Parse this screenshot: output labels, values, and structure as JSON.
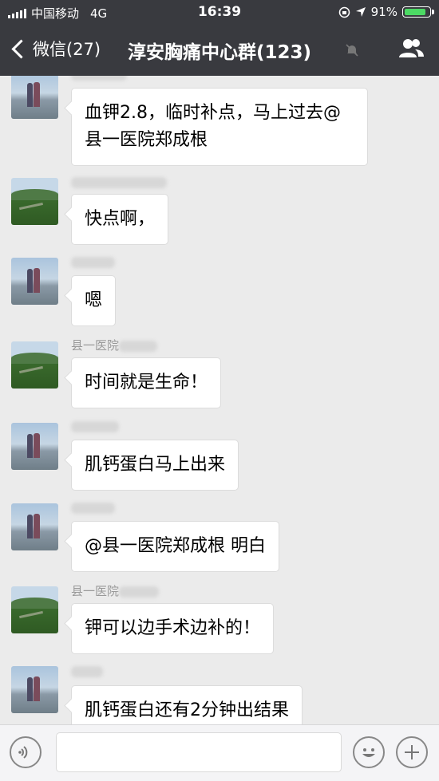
{
  "status_bar": {
    "carrier": "中国移动",
    "network": "4G",
    "time": "16:39",
    "battery": "91%",
    "battery_level": 0.91
  },
  "nav": {
    "back_label": "微信(27)",
    "title": "淳安胸痛中心群(123)"
  },
  "messages": [
    {
      "avatar": "beach-avatar",
      "sender": "",
      "text_lines": [
        "血钾2.8，临时补点，马上过去@",
        "县一医院郑成根"
      ]
    },
    {
      "avatar": "hill-avatar",
      "sender": "",
      "text_lines": [
        "快点啊，"
      ]
    },
    {
      "avatar": "beach-avatar",
      "sender": "",
      "text_lines": [
        "嗯"
      ]
    },
    {
      "avatar": "hill-avatar",
      "sender": "县一医院",
      "text_lines": [
        "时间就是生命！"
      ]
    },
    {
      "avatar": "beach-avatar",
      "sender": "",
      "text_lines": [
        "肌钙蛋白马上出来"
      ]
    },
    {
      "avatar": "beach-avatar",
      "sender": "",
      "text_lines": [
        "@县一医院郑成根 明白"
      ]
    },
    {
      "avatar": "hill-avatar",
      "sender": "县一医院",
      "text_lines": [
        "钾可以边手术边补的！"
      ]
    },
    {
      "avatar": "beach-avatar",
      "sender": "",
      "text_lines": [
        "肌钙蛋白还有2分钟出结果"
      ]
    }
  ],
  "icons": {
    "back": "chevron-left-icon",
    "mute": "mute-bell-icon",
    "members": "group-members-icon",
    "voice": "voice-input-icon",
    "emoji": "emoji-icon",
    "more": "plus-icon"
  },
  "colors": {
    "nav_bg": "#393a3f",
    "chat_bg": "#ebebeb",
    "battery": "#4cd964"
  }
}
